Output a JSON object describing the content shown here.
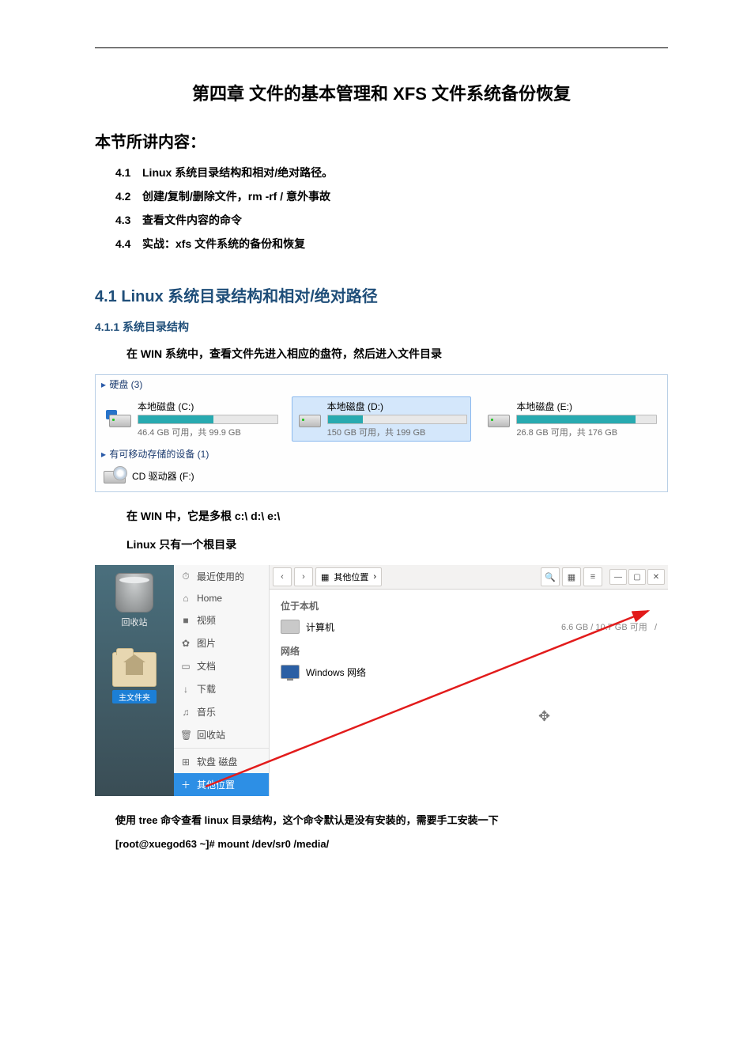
{
  "chapter_title": "第四章  文件的基本管理和 XFS 文件系统备份恢复",
  "section_heading": "本节所讲内容：",
  "toc": [
    {
      "num": "4.1",
      "text": "Linux 系统目录结构和相对/绝对路径。"
    },
    {
      "num": "4.2",
      "text": "创建/复制/删除文件，rm -rf / 意外事故"
    },
    {
      "num": "4.3",
      "text": "查看文件内容的命令"
    },
    {
      "num": "4.4",
      "text": "实战：xfs 文件系统的备份和恢复"
    }
  ],
  "h2_41": "4.1 Linux 系统目录结构和相对/绝对路径",
  "h3_411": "4.1.1 系统目录结构",
  "para_win_intro": "在 WIN 系统中，查看文件先进入相应的盘符，然后进入文件目录",
  "win_panel": {
    "group_disks": "硬盘 (3)",
    "group_removable": "有可移动存储的设备 (1)",
    "drives": [
      {
        "label": "本地磁盘 (C:)",
        "stats": "46.4 GB 可用，共 99.9 GB",
        "fill": 54
      },
      {
        "label": "本地磁盘 (D:)",
        "stats": "150 GB 可用，共 199 GB",
        "fill": 25
      },
      {
        "label": "本地磁盘 (E:)",
        "stats": "26.8 GB 可用，共 176 GB",
        "fill": 85
      }
    ],
    "cd_label": "CD 驱动器 (F:)"
  },
  "para_multiroot": "在 WIN 中，它是多根   c:\\       d:\\      e:\\",
  "para_singleroot": "Linux 只有一个根目录",
  "linux": {
    "trash_label": "回收站",
    "home_tag": "主文件夹",
    "sidebar": [
      {
        "icon": "⏱",
        "label": "最近使用的"
      },
      {
        "icon": "⌂",
        "label": "Home"
      },
      {
        "icon": "■",
        "label": "视频"
      },
      {
        "icon": "✿",
        "label": "图片"
      },
      {
        "icon": "▭",
        "label": "文档"
      },
      {
        "icon": "↓",
        "label": "下载"
      },
      {
        "icon": "♫",
        "label": "音乐"
      },
      {
        "icon": "🗑",
        "label": "回收站"
      },
      {
        "icon": "⊞",
        "label": "软盘 磁盘"
      },
      {
        "icon": "＋",
        "label": "其他位置"
      }
    ],
    "crumb_label": "其他位置",
    "content": {
      "hdr_local": "位于本机",
      "computer": "计算机",
      "computer_meta": "6.6 GB / 10.7 GB 可用",
      "computer_path": "/",
      "hdr_network": "网络",
      "win_network": "Windows 网络"
    }
  },
  "para_tree": "使用 tree 命令查看 linux 目录结构，这个命令默认是没有安装的，需要手工安装一下",
  "para_cmd": "[root@xuegod63 ~]# mount /dev/sr0   /media/"
}
